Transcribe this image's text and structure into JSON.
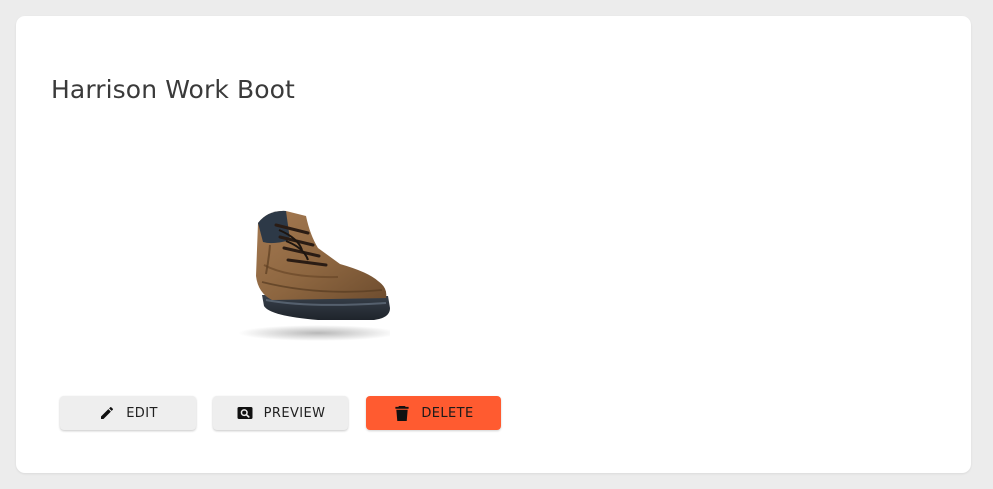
{
  "product": {
    "title": "Harrison Work Boot",
    "image_alt": "Brown leather work boot"
  },
  "actions": {
    "edit_label": "EDIT",
    "preview_label": "PREVIEW",
    "delete_label": "DELETE"
  },
  "icons": {
    "edit": "pencil-icon",
    "preview": "search-icon",
    "delete": "trash-icon"
  },
  "colors": {
    "page_background": "#ececec",
    "card_background": "#ffffff",
    "title_text": "#3a3a3a",
    "secondary_button": "#eeeeee",
    "danger_button": "#ff5b30"
  }
}
